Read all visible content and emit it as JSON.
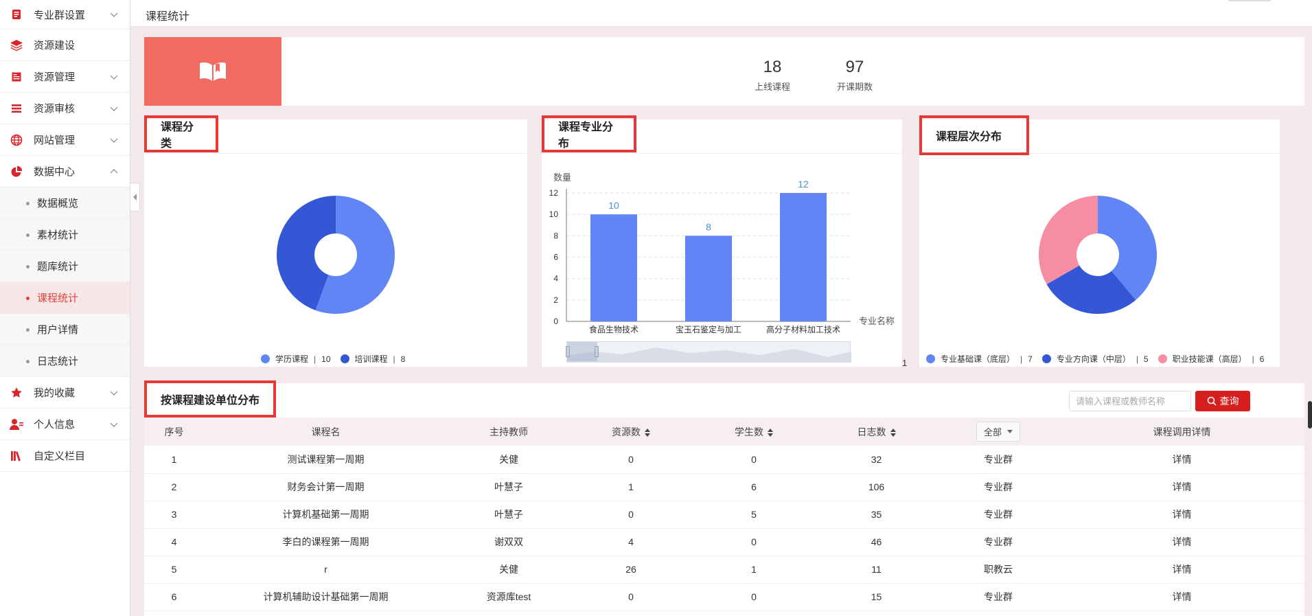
{
  "sidebar": {
    "items": [
      {
        "label": "专业群设置",
        "icon": "list-icon"
      },
      {
        "label": "资源建设",
        "icon": "layers-icon"
      },
      {
        "label": "资源管理",
        "icon": "document-icon"
      },
      {
        "label": "资源审核",
        "icon": "menu-icon"
      },
      {
        "label": "网站管理",
        "icon": "globe-icon"
      },
      {
        "label": "数据中心",
        "icon": "pie-chart-icon"
      },
      {
        "label": "我的收藏",
        "icon": "star-icon"
      },
      {
        "label": "个人信息",
        "icon": "user-icon"
      },
      {
        "label": "自定义栏目",
        "icon": "books-icon"
      }
    ],
    "sub_items": [
      "数据概览",
      "素材统计",
      "题库统计",
      "课程统计",
      "用户详情",
      "日志统计"
    ],
    "active_sub": "课程统计"
  },
  "header": {
    "breadcrumb": "课程统计"
  },
  "stats": {
    "icon": "open-book-icon",
    "online_courses": {
      "value": "18",
      "label": "上线课程"
    },
    "terms": {
      "value": "97",
      "label": "开课期数"
    }
  },
  "cards": {
    "category": {
      "title": "课程分类",
      "legend": [
        {
          "name": "学历课程",
          "count": "10"
        },
        {
          "name": "培训课程",
          "count": "8"
        }
      ]
    },
    "major": {
      "title": "课程专业分布",
      "page_indicator": "1"
    },
    "level": {
      "title": "课程层次分布",
      "legend": [
        {
          "name": "专业基础课（底层）",
          "count": "7"
        },
        {
          "name": "专业方向课（中层）",
          "count": "5"
        },
        {
          "name": "职业技能课（高层）",
          "count": "6"
        }
      ]
    }
  },
  "chart_data": [
    {
      "type": "pie",
      "categories": [
        "学历课程",
        "培训课程"
      ],
      "values": [
        10,
        8
      ],
      "colors": [
        "#6185f5",
        "#3457d5"
      ]
    },
    {
      "type": "bar",
      "categories": [
        "食品生物技术",
        "宝玉石鉴定与加工",
        "高分子材料加工技术"
      ],
      "values": [
        10,
        8,
        12
      ],
      "ylabel": "数量",
      "xlabel": "专业名称",
      "ylim": [
        0,
        12
      ],
      "yticks": [
        "0",
        "2",
        "4",
        "6",
        "8",
        "10",
        "12"
      ],
      "grid": true,
      "color": "#6185f5",
      "label_color": "#4a90d9"
    },
    {
      "type": "pie",
      "categories": [
        "专业基础课（底层）",
        "专业方向课（中层）",
        "职业技能课（高层）"
      ],
      "values": [
        7,
        5,
        6
      ],
      "colors": [
        "#6185f5",
        "#3457d5",
        "#f78da2"
      ]
    }
  ],
  "table": {
    "title": "按课程建设单位分布",
    "search_placeholder": "请输入课程或教师名称",
    "search_button": "查询",
    "columns": {
      "index": "序号",
      "name": "课程名",
      "teacher": "主持教师",
      "resources": "资源数",
      "students": "学生数",
      "logs": "日志数",
      "filter": "全部",
      "detail": "课程调用详情"
    },
    "rows": [
      {
        "index": "1",
        "name": "测试课程第一周期",
        "teacher": "关健",
        "resources": "0",
        "students": "0",
        "logs": "32",
        "source": "专业群",
        "detail": "详情"
      },
      {
        "index": "2",
        "name": "财务会计第一周期",
        "teacher": "叶慧子",
        "resources": "1",
        "students": "6",
        "logs": "106",
        "source": "专业群",
        "detail": "详情"
      },
      {
        "index": "3",
        "name": "计算机基础第一周期",
        "teacher": "叶慧子",
        "resources": "0",
        "students": "5",
        "logs": "35",
        "source": "专业群",
        "detail": "详情"
      },
      {
        "index": "4",
        "name": "李白的课程第一周期",
        "teacher": "谢双双",
        "resources": "4",
        "students": "0",
        "logs": "46",
        "source": "专业群",
        "detail": "详情"
      },
      {
        "index": "5",
        "name": "r",
        "teacher": "关健",
        "resources": "26",
        "students": "1",
        "logs": "11",
        "source": "职教云",
        "detail": "详情"
      },
      {
        "index": "6",
        "name": "计算机辅助设计基础第一周期",
        "teacher": "资源库test",
        "resources": "0",
        "students": "0",
        "logs": "15",
        "source": "专业群",
        "detail": "详情"
      }
    ]
  },
  "colors": {
    "accent": "#e53935",
    "banner": "#f26b63",
    "button": "#d61e1e"
  }
}
